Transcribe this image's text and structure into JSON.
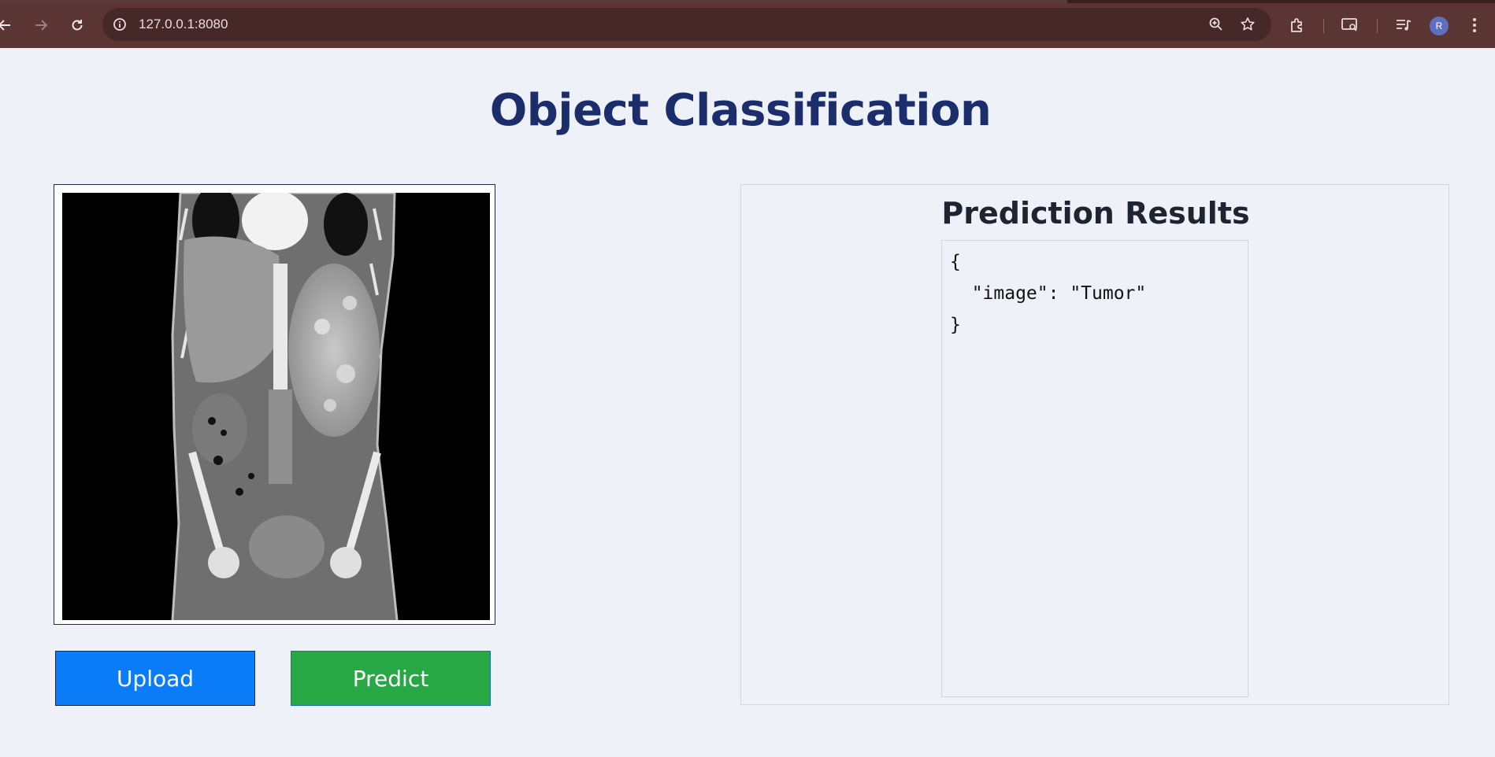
{
  "browser": {
    "url": "127.0.0.1:8080",
    "profile_initial": "R",
    "icons": {
      "back": "back-arrow-icon",
      "forward": "forward-arrow-icon",
      "reload": "reload-icon",
      "site_info": "site-info-icon",
      "zoom": "zoom-icon",
      "bookmark": "bookmark-star-icon",
      "extensions": "extensions-puzzle-icon",
      "cast": "cast-search-icon",
      "media": "media-queue-icon",
      "menu": "kebab-menu-icon"
    },
    "colors": {
      "toolbar": "#5b3434",
      "omnibox": "#472828"
    }
  },
  "page": {
    "title": "Object Classification",
    "image": {
      "alt": "CT scan coronal view"
    },
    "buttons": {
      "upload_label": "Upload",
      "predict_label": "Predict"
    },
    "results": {
      "title": "Prediction Results",
      "json_lines": [
        "{",
        "  \"image\": \"Tumor\"",
        "}"
      ]
    },
    "colors": {
      "title": "#1c2d6b",
      "upload": "#0a7cf7",
      "predict": "#28a745",
      "background": "#eef1f8"
    }
  }
}
